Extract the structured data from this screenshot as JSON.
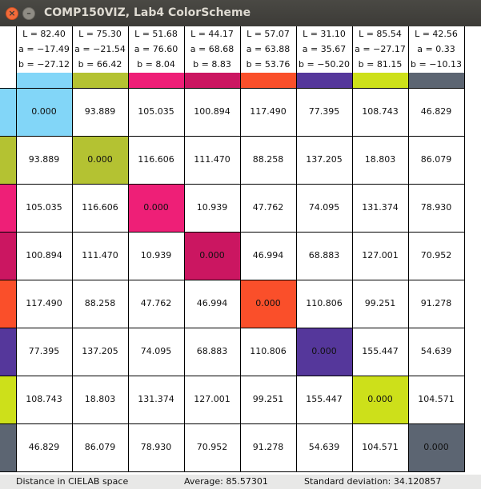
{
  "window": {
    "title": "COMP150VIZ, Lab4 ColorScheme",
    "close_glyph": "×",
    "minimize_glyph": "–"
  },
  "colors": [
    {
      "hex": "#82d6f8",
      "L": "L = 82.40",
      "a": "a = −17.49",
      "b": "b = −27.12"
    },
    {
      "hex": "#b4c232",
      "L": "L = 75.30",
      "a": "a = −21.54",
      "b": "b = 66.42"
    },
    {
      "hex": "#ee1f77",
      "L": "L = 51.68",
      "a": "a = 76.60",
      "b": "b = 8.04"
    },
    {
      "hex": "#cb1661",
      "L": "L = 44.17",
      "a": "a = 68.68",
      "b": "b = 8.83"
    },
    {
      "hex": "#fa4f2a",
      "L": "L = 57.07",
      "a": "a = 63.88",
      "b": "b = 53.76"
    },
    {
      "hex": "#55379b",
      "L": "L = 31.10",
      "a": "a = 35.67",
      "b": "b = −50.20"
    },
    {
      "hex": "#cde01a",
      "L": "L = 85.54",
      "a": "a = −27.17",
      "b": "b = 81.15"
    },
    {
      "hex": "#5c6572",
      "L": "L = 42.56",
      "a": "a = 0.33",
      "b": "b = −10.13"
    }
  ],
  "matrix": [
    [
      "0.000",
      "93.889",
      "105.035",
      "100.894",
      "117.490",
      "77.395",
      "108.743",
      "46.829"
    ],
    [
      "93.889",
      "0.000",
      "116.606",
      "111.470",
      "88.258",
      "137.205",
      "18.803",
      "86.079"
    ],
    [
      "105.035",
      "116.606",
      "0.000",
      "10.939",
      "47.762",
      "74.095",
      "131.374",
      "78.930"
    ],
    [
      "100.894",
      "111.470",
      "10.939",
      "0.000",
      "46.994",
      "68.883",
      "127.001",
      "70.952"
    ],
    [
      "117.490",
      "88.258",
      "47.762",
      "46.994",
      "0.000",
      "110.806",
      "99.251",
      "91.278"
    ],
    [
      "77.395",
      "137.205",
      "74.095",
      "68.883",
      "110.806",
      "0.000",
      "155.447",
      "54.639"
    ],
    [
      "108.743",
      "18.803",
      "131.374",
      "127.001",
      "99.251",
      "155.447",
      "0.000",
      "104.571"
    ],
    [
      "46.829",
      "86.079",
      "78.930",
      "70.952",
      "91.278",
      "54.639",
      "104.571",
      "0.000"
    ]
  ],
  "status": {
    "space": "Distance in CIELAB space",
    "average": "Average: 85.57301",
    "stddev": "Standard deviation: 34.120857"
  }
}
